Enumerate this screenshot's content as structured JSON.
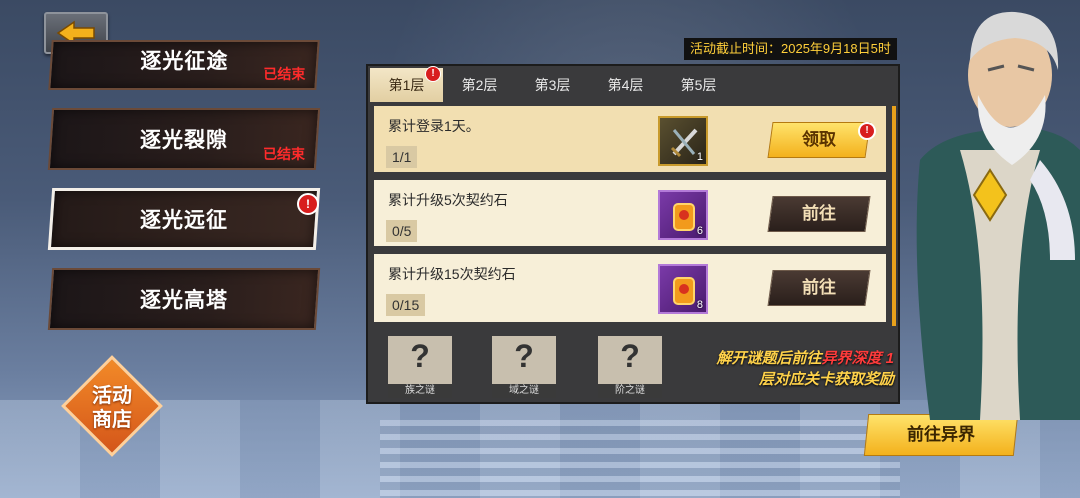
{
  "header": {
    "back_icon": "back-arrow-icon",
    "deadline": "活动截止时间：2025年9月18日5时"
  },
  "sidebar": {
    "items": [
      {
        "label": "逐光征途",
        "status": "已结束"
      },
      {
        "label": "逐光裂隙",
        "status": "已结束"
      },
      {
        "label": "逐光远征",
        "alert": "!"
      },
      {
        "label": "逐光高塔"
      }
    ]
  },
  "shop": {
    "label_line1": "活动",
    "label_line2": "商店"
  },
  "tabs": [
    {
      "label": "第1层",
      "alert": "!"
    },
    {
      "label": "第2层"
    },
    {
      "label": "第3层"
    },
    {
      "label": "第4层"
    },
    {
      "label": "第5层"
    }
  ],
  "tasks": [
    {
      "desc": "累计登录1天。",
      "progress": "1/1",
      "item_count": "1",
      "item_icon": "sword-icon",
      "button": "领取",
      "alert": "!"
    },
    {
      "desc": "累计升级5次契约石",
      "progress": "0/5",
      "item_count": "6",
      "item_icon": "charm-icon",
      "button": "前往"
    },
    {
      "desc": "累计升级15次契约石",
      "progress": "0/15",
      "item_count": "8",
      "item_icon": "charm-icon",
      "button": "前往"
    }
  ],
  "mysteries": [
    {
      "mark": "?",
      "label": "族之谜"
    },
    {
      "mark": "?",
      "label": "域之谜"
    },
    {
      "mark": "?",
      "label": "阶之谜"
    }
  ],
  "hint": {
    "part1": "解开谜题后前往",
    "highlight": "异界深度 1",
    "part2": "层对应关卡获取奖励"
  },
  "go_button": "前往异界",
  "colors": {
    "accent_gold": "#f3b11c",
    "alert_red": "#d81e1e",
    "ended_red": "#ff2b2b"
  }
}
